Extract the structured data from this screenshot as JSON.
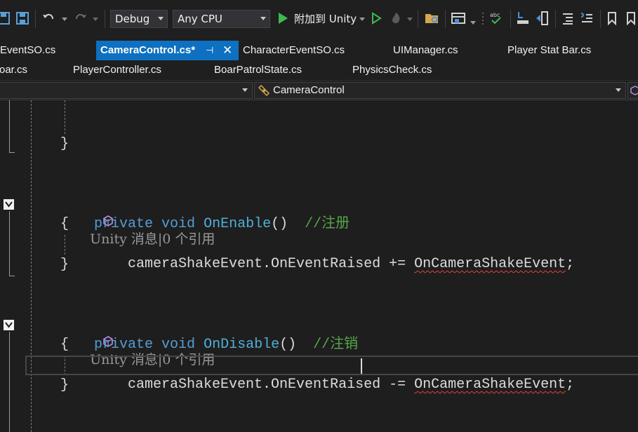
{
  "toolbar": {
    "config_value": "Debug",
    "platform_value": "Any CPU",
    "attach_label": "附加到 Unity"
  },
  "tabs_row1": [
    {
      "label": "EventSO.cs"
    },
    {
      "label": "CameraControl.cs*",
      "active": true
    },
    {
      "label": "CharacterEventSO.cs"
    },
    {
      "label": "UIManager.cs"
    },
    {
      "label": "Player Stat Bar.cs"
    }
  ],
  "tabs_row2": [
    {
      "label": "oar.cs"
    },
    {
      "label": "PlayerController.cs"
    },
    {
      "label": "BoarPatrolState.cs"
    },
    {
      "label": "PhysicsCheck.cs"
    }
  ],
  "navbar": {
    "member_value": "CameraControl"
  },
  "code": {
    "brace_close_top": "}",
    "codelens1": "Unity 消息|0 个引用",
    "kw_private": "private",
    "kw_void": "void",
    "fn_enable": "OnEnable",
    "parens": "()",
    "comment_enable": "//注册",
    "brace_open": "{",
    "stmt_enable_left": "cameraShakeEvent.OnEventRaised += ",
    "stmt_handler": "OnCameraShakeEvent",
    "semicolon": ";",
    "brace_close": "}",
    "codelens2": "Unity 消息|0 个引用",
    "fn_disable": "OnDisable",
    "comment_disable": "//注销",
    "stmt_disable_left": "cameraShakeEvent.OnEventRaised ",
    "stmt_disable_op": "-",
    "stmt_disable_op2": "= "
  },
  "colors": {
    "keyword": "#569cd6",
    "comment": "#57a64a",
    "active_tab": "#0e70c0",
    "error_squiggle": "#e8413b"
  }
}
